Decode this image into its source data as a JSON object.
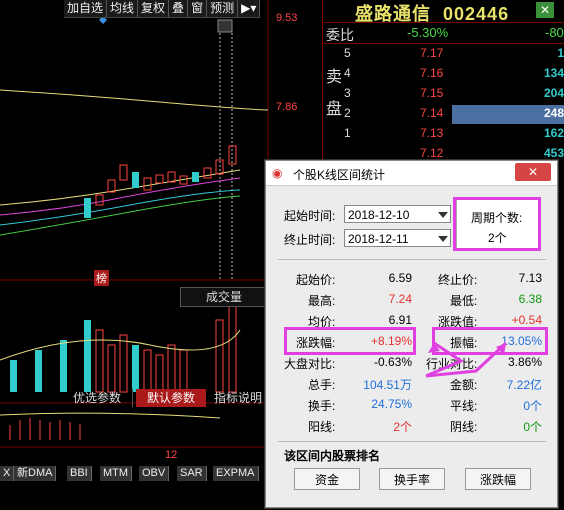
{
  "toolbar": {
    "items": [
      "加自选",
      "均线",
      "复权",
      "叠",
      "窗",
      "预测"
    ]
  },
  "chart": {
    "price_high": "9.53",
    "price_mid": "7.86",
    "marker_bang": "榜",
    "volume_label": "成交量",
    "axis_12": "12",
    "indicator_tabs": [
      "优选参数",
      "默认参数",
      "指标说明"
    ],
    "bottom_tabs": [
      "X",
      "新DMA",
      "BBI",
      "MTM",
      "OBV",
      "SAR",
      "EXPMA"
    ]
  },
  "quote": {
    "name": "盛路通信",
    "code": "002446",
    "webi_label": "委比",
    "webi_value": "-5.30%",
    "webi_right": "-80",
    "sell_label": "卖盘",
    "asks": [
      {
        "level": "5",
        "price": "7.17",
        "vol": "1"
      },
      {
        "level": "4",
        "price": "7.16",
        "vol": "134"
      },
      {
        "level": "3",
        "price": "7.15",
        "vol": "204"
      },
      {
        "level": "2",
        "price": "7.14",
        "vol": "248"
      },
      {
        "level": "1",
        "price": "7.13",
        "vol": "162"
      },
      {
        "level": "",
        "price": "7.12",
        "vol": "453"
      }
    ]
  },
  "dialog": {
    "title": "个股K线区间统计",
    "start_label": "起始时间:",
    "start_value": "2018-12-10",
    "end_label": "终止时间:",
    "end_value": "2018-12-11",
    "period_label": "周期个数:",
    "period_value": "2个",
    "stats": {
      "start_price_label": "起始价:",
      "start_price": "6.59",
      "end_price_label": "终止价:",
      "end_price": "7.13",
      "high_label": "最高:",
      "high": "7.24",
      "low_label": "最低:",
      "low": "6.38",
      "avg_label": "均价:",
      "avg": "6.91",
      "change_label": "涨跌值:",
      "change": "+0.54",
      "pct_label": "涨跌幅:",
      "pct": "+8.19%",
      "amp_label": "振幅:",
      "amp": "13.05%",
      "market_label": "大盘对比:",
      "market": "-0.63%",
      "industry_label": "行业对比:",
      "industry": "3.86%",
      "volume_label": "总手:",
      "volume": "104.51万",
      "amount_label": "金额:",
      "amount": "7.22亿",
      "turnover_label": "换手:",
      "turnover": "24.75%",
      "flat_label": "平线:",
      "flat": "0个",
      "yang_label": "阳线:",
      "yang": "2个",
      "yin_label": "阴线:",
      "yin": "0个"
    },
    "rank_title": "该区间内股票排名",
    "buttons": [
      "资金",
      "换手率",
      "涨跌幅"
    ],
    "close_label": "✕"
  },
  "colors": {
    "highlight": "#e040e0",
    "up": "#e53030",
    "down": "#109a10",
    "blue": "#1e6fd9"
  }
}
